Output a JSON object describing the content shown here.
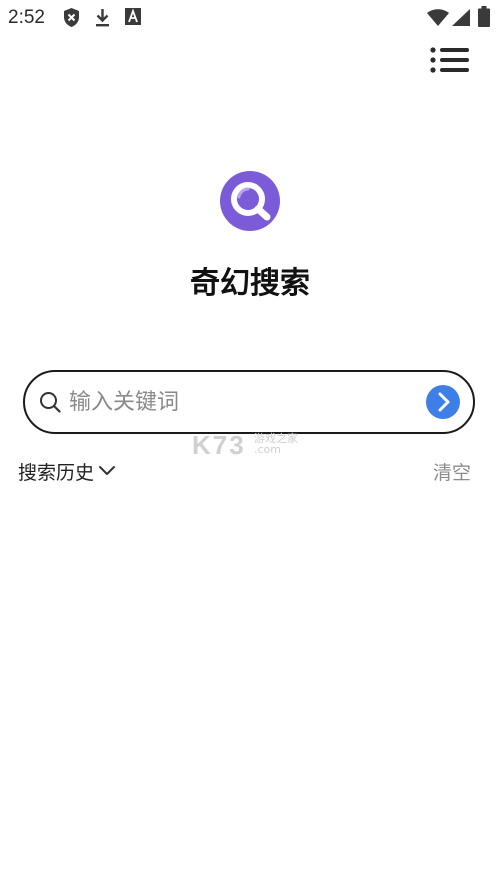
{
  "status_bar": {
    "time": "2:52",
    "icons": [
      "shield-x-icon",
      "download-icon",
      "a-box-icon",
      "wifi-icon",
      "cellular-signal-icon",
      "battery-icon"
    ]
  },
  "header": {
    "menu_icon": "list-menu-icon"
  },
  "app": {
    "title": "奇幻搜索",
    "logo_icon": "magnifier-logo-icon",
    "logo_color": "#7b5bd8"
  },
  "search": {
    "placeholder": "输入关键词",
    "value": "",
    "submit_color": "#3d7fe6"
  },
  "history": {
    "label": "搜索历史",
    "clear_label": "清空"
  },
  "watermark": {
    "brand": "K73",
    "line1": "游戏之家",
    "line2": ".com"
  }
}
